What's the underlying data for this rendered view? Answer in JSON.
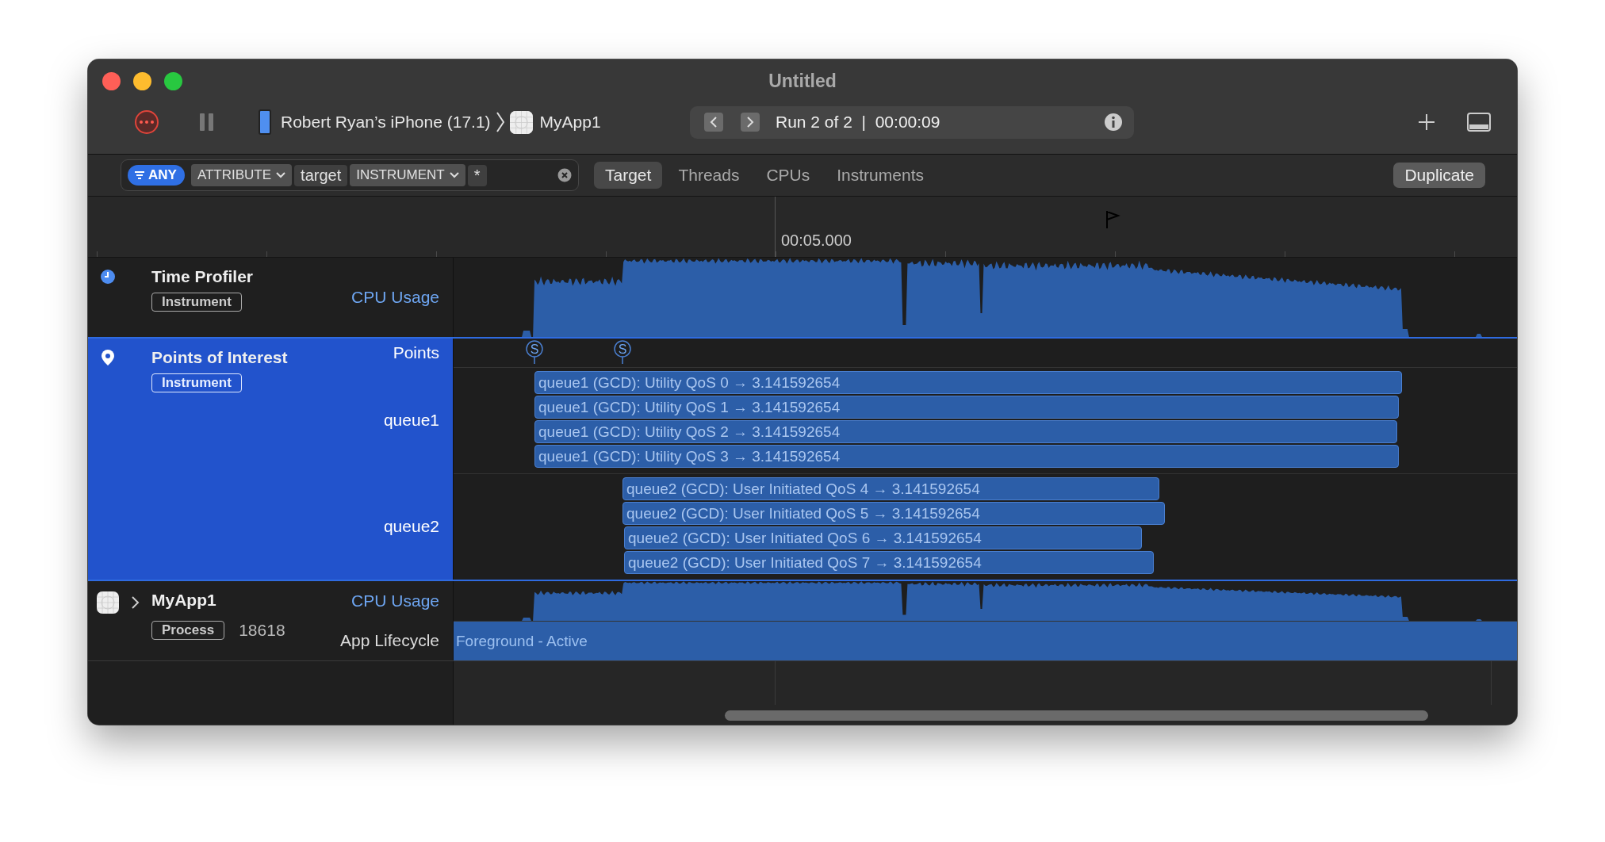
{
  "window": {
    "title": "Untitled"
  },
  "toolbar": {
    "device": "Robert Ryan’s iPhone (17.1)",
    "target": "MyApp1",
    "run": "Run 2 of 2  |  00:00:09"
  },
  "filter": {
    "mode": "ANY",
    "tokens": [
      {
        "kind": "menu",
        "label": "ATTRIBUTE"
      },
      {
        "kind": "text",
        "label": "target"
      },
      {
        "kind": "menu",
        "label": "INSTRUMENT"
      },
      {
        "kind": "text",
        "label": "*"
      }
    ]
  },
  "scope_tabs": [
    {
      "label": "Target",
      "selected": true
    },
    {
      "label": "Threads",
      "selected": false
    },
    {
      "label": "CPUs",
      "selected": false
    },
    {
      "label": "Instruments",
      "selected": false
    }
  ],
  "duplicate_button": "Duplicate",
  "ruler": {
    "label": "00:05.000"
  },
  "tracks": [
    {
      "kind": "clock",
      "name": "Time Profiler",
      "tag": "Instrument",
      "selected": false,
      "lanes": [
        {
          "kind": "graph",
          "label": "CPU Usage"
        }
      ]
    },
    {
      "kind": "pin",
      "name": "Points of Interest",
      "tag": "Instrument",
      "selected": true,
      "lanes": [
        {
          "kind": "points",
          "label": "Points",
          "markers": [
            "S",
            "S"
          ]
        },
        {
          "kind": "intervals",
          "label": "queue1",
          "intervals": [
            "queue1 (GCD): Utility QoS 0 → 3.141592654",
            "queue1 (GCD): Utility QoS 1 → 3.141592654",
            "queue1 (GCD): Utility QoS 2 → 3.141592654",
            "queue1 (GCD): Utility QoS 3 → 3.141592654"
          ]
        },
        {
          "kind": "intervals",
          "label": "queue2",
          "intervals": [
            "queue2 (GCD): User Initiated QoS 4 → 3.141592654",
            "queue2 (GCD): User Initiated QoS 5 → 3.141592654",
            "queue2 (GCD): User Initiated QoS 6 → 3.141592654",
            "queue2 (GCD): User Initiated QoS 7 → 3.141592654"
          ]
        }
      ]
    },
    {
      "kind": "app",
      "name": "MyApp1",
      "tag": "Process",
      "pid": "18618",
      "expanded": false,
      "selected": false,
      "lanes": [
        {
          "kind": "graph",
          "label": "CPU Usage"
        },
        {
          "kind": "band",
          "label": "App Lifecycle",
          "band": "Foreground - Active"
        }
      ]
    }
  ]
}
